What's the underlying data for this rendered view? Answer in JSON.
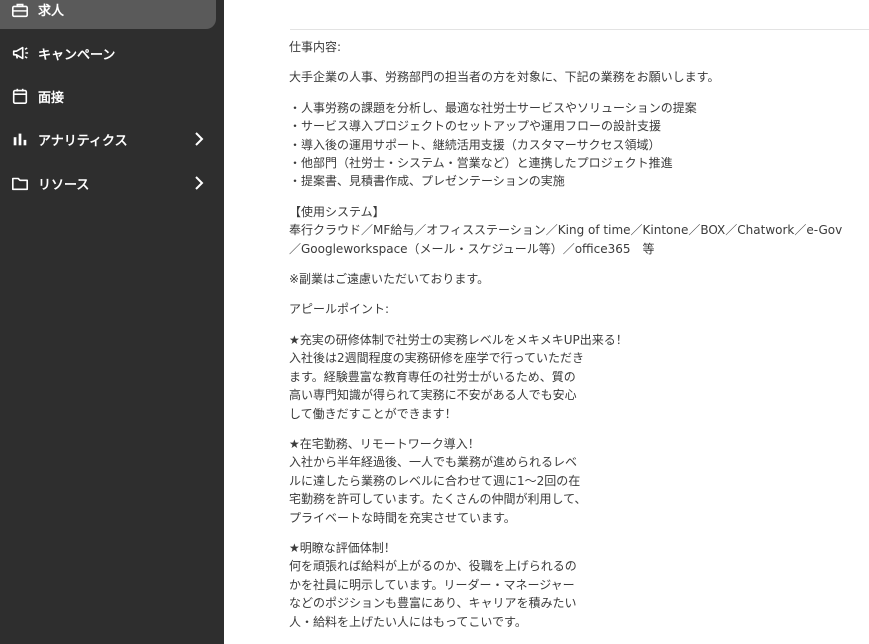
{
  "sidebar": {
    "items": [
      {
        "label": "求人",
        "icon": "briefcase-icon"
      },
      {
        "label": "キャンペーン",
        "icon": "megaphone-icon"
      },
      {
        "label": "面接",
        "icon": "calendar-icon"
      },
      {
        "label": "アナリティクス",
        "icon": "bar-chart-icon"
      },
      {
        "label": "リソース",
        "icon": "folder-icon"
      }
    ]
  },
  "content": {
    "job_heading": "仕事内容:",
    "intro": "大手企業の人事、労務部門の担当者の方を対象に、下記の業務をお願いします。",
    "bullets": [
      "・人事労務の課題を分析し、最適な社労士サービスやソリューションの提案",
      "・サービス導入プロジェクトのセットアップや運用フローの設計支援",
      "・導入後の運用サポート、継続活用支援（カスタマーサクセス領域）",
      "・他部門（社労士・システム・営業など）と連携したプロジェクト推進",
      "・提案書、見積書作成、プレゼンテーションの実施"
    ],
    "systems_heading": "【使用システム】",
    "systems_lines": [
      "奉行クラウド／MF給与／オフィスステーション／King of time／Kintone／BOX／Chatwork／e-Gov",
      "／Googleworkspace（メール・スケジュール等）／office365　等"
    ],
    "side_job_note": "※副業はご遠慮いただいております。",
    "appeal_heading": "アピールポイント:",
    "appeals": [
      [
        "★充実の研修体制で社労士の実務レベルをメキメキUP出来る！",
        "入社後は2週間程度の実務研修を座学で行っていただき",
        "ます。経験豊富な教育専任の社労士がいるため、質の",
        "高い専門知識が得られて実務に不安がある人でも安心",
        "して働きだすことができます！"
      ],
      [
        "★在宅勤務、リモートワーク導入！",
        "入社から半年経過後、一人でも業務が進められるレベ",
        "ルに達したら業務のレベルに合わせて週に1〜2回の在",
        "宅勤務を許可しています。たくさんの仲間が利用して、",
        "プライベートな時間を充実させています。"
      ],
      [
        "★明瞭な評価体制！",
        "何を頑張れば給料が上がるのか、役職を上げられるの",
        "かを社員に明示しています。リーダー・マネージャー",
        "などのポジションも豊富にあり、キャリアを積みたい",
        "人・給料を上げたい人にはもってこいです。"
      ]
    ]
  }
}
